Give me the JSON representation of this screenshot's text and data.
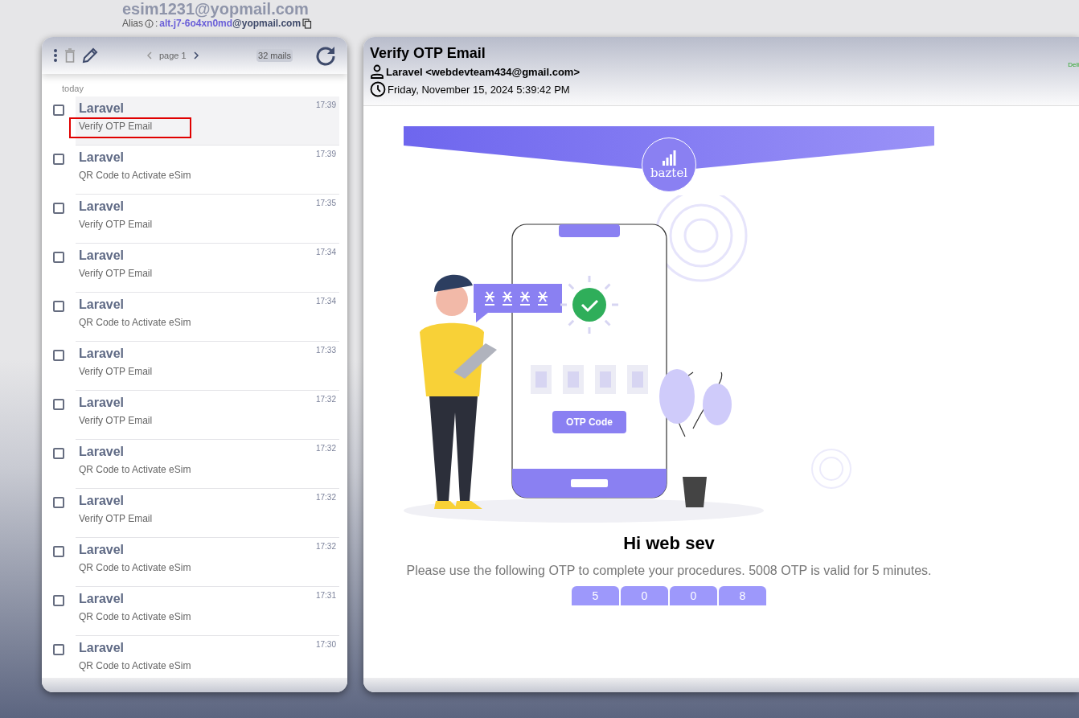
{
  "header": {
    "address": "esim1231@yopmail.com",
    "alias_label": "Alias",
    "alias_separator": ":",
    "alias_local": "alt.j7-6o4xn0md",
    "alias_domain": "@yopmail.com"
  },
  "toolbar": {
    "page": "page 1",
    "count": "32 mails"
  },
  "mail_list": {
    "group": "today",
    "mails": [
      {
        "sender": "Laravel",
        "subject": "Verify OTP Email",
        "time": "17:39",
        "selected": true,
        "checked": false
      },
      {
        "sender": "Laravel",
        "subject": "QR Code to Activate eSim",
        "time": "17:39",
        "selected": false,
        "checked": false
      },
      {
        "sender": "Laravel",
        "subject": "Verify OTP Email",
        "time": "17:35",
        "selected": false,
        "checked": false
      },
      {
        "sender": "Laravel",
        "subject": "Verify OTP Email",
        "time": "17:34",
        "selected": false,
        "checked": false
      },
      {
        "sender": "Laravel",
        "subject": "QR Code to Activate eSim",
        "time": "17:34",
        "selected": false,
        "checked": false
      },
      {
        "sender": "Laravel",
        "subject": "Verify OTP Email",
        "time": "17:33",
        "selected": false,
        "checked": false
      },
      {
        "sender": "Laravel",
        "subject": "Verify OTP Email",
        "time": "17:32",
        "selected": false,
        "checked": false
      },
      {
        "sender": "Laravel",
        "subject": "QR Code to Activate eSim",
        "time": "17:32",
        "selected": false,
        "checked": false
      },
      {
        "sender": "Laravel",
        "subject": "Verify OTP Email",
        "time": "17:32",
        "selected": false,
        "checked": false
      },
      {
        "sender": "Laravel",
        "subject": "QR Code to Activate eSim",
        "time": "17:32",
        "selected": false,
        "checked": false
      },
      {
        "sender": "Laravel",
        "subject": "QR Code to Activate eSim",
        "time": "17:31",
        "selected": false,
        "checked": false
      },
      {
        "sender": "Laravel",
        "subject": "QR Code to Activate eSim",
        "time": "17:30",
        "selected": false,
        "checked": false
      }
    ]
  },
  "message": {
    "subject": "Verify OTP Email",
    "from": "Laravel <webdevteam434@gmail.com>",
    "date": "Friday, November 15, 2024 5:39:42 PM",
    "status": "Deli",
    "logo": "baztel",
    "illustration_button": "OTP Code",
    "greeting": "Hi web sev",
    "body": "Please use the following OTP to complete your procedures. 5008 OTP is valid for 5 minutes.",
    "otp_digits": [
      "5",
      "0",
      "0",
      "8"
    ]
  }
}
